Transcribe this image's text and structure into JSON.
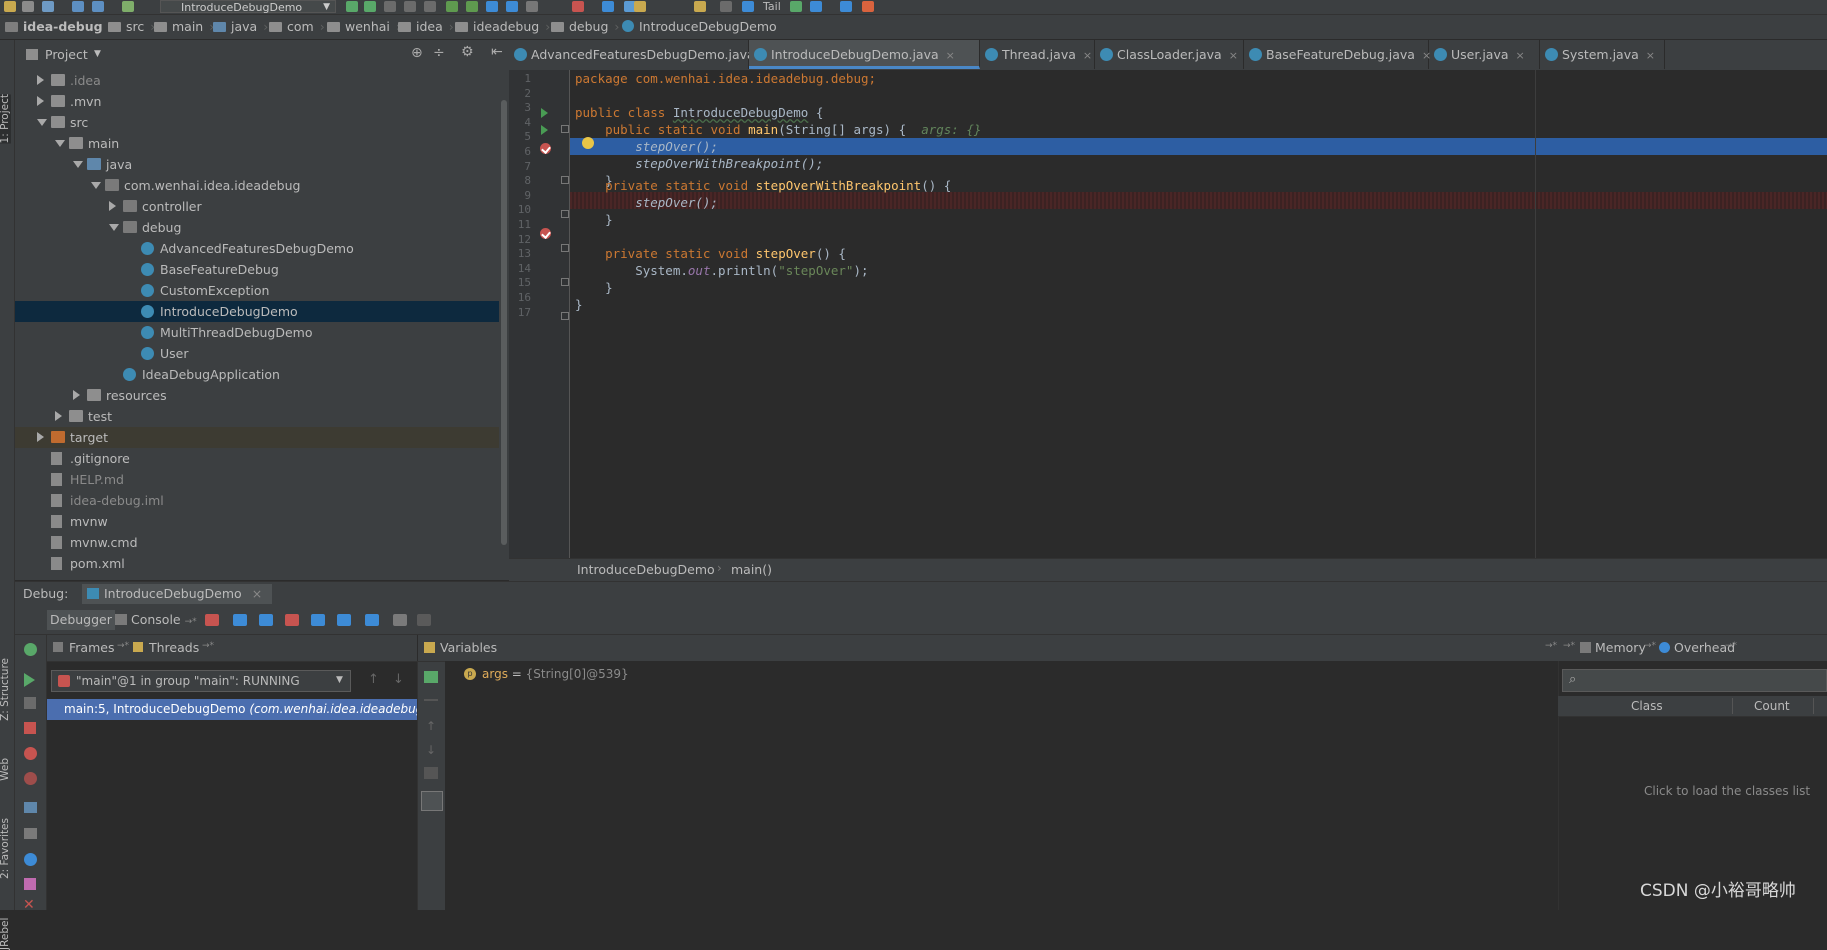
{
  "toolbar": {
    "run_config": "IntroduceDebugDemo",
    "tail_label": "Tail"
  },
  "navbar": {
    "crumbs": [
      "idea-debug",
      "src",
      "main",
      "java",
      "com",
      "wenhai",
      "idea",
      "ideadebug",
      "debug",
      "IntroduceDebugDemo"
    ]
  },
  "left_strip": {
    "project_tab": "1: Project",
    "structure_tab": "Z: Structure",
    "web_tab": "Web",
    "favorites_tab": "2: Favorites",
    "jrebel_tab": "JRebel"
  },
  "project_panel": {
    "title": "Project",
    "tree": [
      {
        "label": ".idea",
        "depth": 1,
        "expand": "right",
        "icon": "folder",
        "dim": true
      },
      {
        "label": ".mvn",
        "depth": 1,
        "expand": "right",
        "icon": "folder"
      },
      {
        "label": "src",
        "depth": 1,
        "expand": "down",
        "icon": "folder"
      },
      {
        "label": "main",
        "depth": 2,
        "expand": "down",
        "icon": "folder"
      },
      {
        "label": "java",
        "depth": 3,
        "expand": "down",
        "icon": "folder blue"
      },
      {
        "label": "com.wenhai.idea.ideadebug",
        "depth": 4,
        "expand": "down",
        "icon": "pkg"
      },
      {
        "label": "controller",
        "depth": 5,
        "expand": "right",
        "icon": "pkg"
      },
      {
        "label": "debug",
        "depth": 5,
        "expand": "down",
        "icon": "pkg"
      },
      {
        "label": "AdvancedFeaturesDebugDemo",
        "depth": 6,
        "icon": "cls"
      },
      {
        "label": "BaseFeatureDebug",
        "depth": 6,
        "icon": "cls"
      },
      {
        "label": "CustomException",
        "depth": 6,
        "icon": "cls"
      },
      {
        "label": "IntroduceDebugDemo",
        "depth": 6,
        "icon": "cls",
        "selected": true
      },
      {
        "label": "MultiThreadDebugDemo",
        "depth": 6,
        "icon": "cls"
      },
      {
        "label": "User",
        "depth": 6,
        "icon": "cls"
      },
      {
        "label": "IdeaDebugApplication",
        "depth": 5,
        "icon": "cls"
      },
      {
        "label": "resources",
        "depth": 3,
        "expand": "right",
        "icon": "folder"
      },
      {
        "label": "test",
        "depth": 2,
        "expand": "right",
        "icon": "folder"
      },
      {
        "label": "target",
        "depth": 1,
        "expand": "right",
        "icon": "folder orange",
        "excluded": true
      },
      {
        "label": ".gitignore",
        "depth": 1,
        "icon": "file"
      },
      {
        "label": "HELP.md",
        "depth": 1,
        "icon": "file",
        "dim": true
      },
      {
        "label": "idea-debug.iml",
        "depth": 1,
        "icon": "file",
        "dim": true
      },
      {
        "label": "mvnw",
        "depth": 1,
        "icon": "file"
      },
      {
        "label": "mvnw.cmd",
        "depth": 1,
        "icon": "file"
      },
      {
        "label": "pom.xml",
        "depth": 1,
        "icon": "file"
      }
    ]
  },
  "editor_tabs": [
    {
      "label": "AdvancedFeaturesDebugDemo.java"
    },
    {
      "label": "IntroduceDebugDemo.java",
      "active": true
    },
    {
      "label": "Thread.java"
    },
    {
      "label": "ClassLoader.java"
    },
    {
      "label": "BaseFeatureDebug.java"
    },
    {
      "label": "User.java"
    },
    {
      "label": "System.java"
    }
  ],
  "editor": {
    "line_numbers": [
      "1",
      "2",
      "3",
      "4",
      "5",
      "6",
      "7",
      "8",
      "9",
      "10",
      "11",
      "12",
      "13",
      "14",
      "15",
      "16",
      "17"
    ],
    "lines": {
      "l1": "package com.wenhai.idea.ideadebug.debug;",
      "l3_kw": "public class ",
      "l3_name": "IntroduceDebugDemo",
      "l3_end": " {",
      "l4_kw": "    public static void ",
      "l4_fn": "main",
      "l4_args": "(String[] args) {  ",
      "l4_hint": "args: {}",
      "l5": "        stepOver();",
      "l6": "        stepOverWithBreakpoint();",
      "l7": "    }",
      "l9_kw": "    private static void ",
      "l9_fn": "stepOverWithBreakpoint",
      "l9_end": "() {",
      "l10": "        stepOver();",
      "l11": "    }",
      "l13_kw": "    private static void ",
      "l13_fn": "stepOver",
      "l13_end": "() {",
      "l14_a": "        System.",
      "l14_out": "out",
      "l14_b": ".println(",
      "l14_str": "\"stepOver\"",
      "l14_c": ");",
      "l15": "    }",
      "l16": "}"
    },
    "breadcrumb_class": "IntroduceDebugDemo",
    "breadcrumb_method": "main()"
  },
  "debug": {
    "title": "Debug:",
    "session_tab": "IntroduceDebugDemo",
    "debugger_tab": "Debugger",
    "console_tab": "Console",
    "frames_tab": "Frames",
    "threads_tab": "Threads",
    "thread_select": "\"main\"@1 in group \"main\": RUNNING",
    "frame_item": "main:5, IntroduceDebugDemo",
    "frame_item_pkg": "(com.wenhai.idea.ideadebug.d",
    "variables_tab": "Variables",
    "var_name": "args",
    "var_eq": " = ",
    "var_value": "{String[0]@539}",
    "memory_tab": "Memory",
    "overhead_tab": "Overhead",
    "col_class": "Class",
    "col_count": "Count",
    "memory_hint": "Click to load the classes list"
  },
  "watermark": "CSDN @小裕哥略帅",
  "colors": {
    "selection": "#4b6eaf",
    "breakpoint": "#c75450",
    "keyword": "#cc7832",
    "method": "#ffc66d"
  }
}
